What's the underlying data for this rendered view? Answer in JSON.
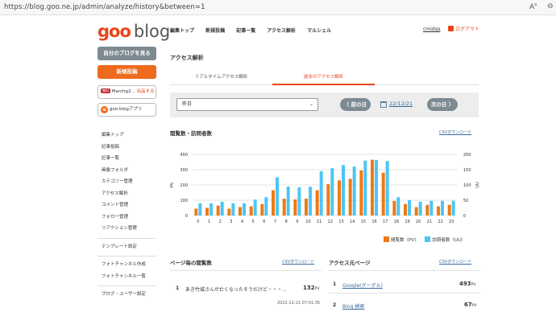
{
  "browser": {
    "url": "https://blog.goo.ne.jp/admin/analyze/history&between=1"
  },
  "header": {
    "logo_goo": "goo",
    "logo_blog": "blog",
    "nav": [
      "編集トップ",
      "新規投稿",
      "記事一覧",
      "アクセス解析",
      "マルシェル"
    ],
    "user": "cmidgs",
    "logout": "ログアウト"
  },
  "sidebar": {
    "my_blog": "自分のブログを見る",
    "new_post": "新規投稿",
    "marchg_badge": "無料",
    "marchg_name": "Marchg2...",
    "marchg_action": "出品する",
    "app_label": "goo blogアプリ",
    "links_group1": [
      "編集トップ",
      "記事投稿",
      "記事一覧",
      "画像フォルダ",
      "カテゴリー管理",
      "アクセス解析",
      "コメント管理",
      "フォロー管理",
      "リアクション管理"
    ],
    "links_group2": [
      "テンプレート設定"
    ],
    "links_group3": [
      "フォトチャンネル作成",
      "フォトチャンネル一覧"
    ],
    "links_group4": [
      "ブログ・ユーザー設定"
    ]
  },
  "main": {
    "title": "アクセス解析",
    "tabs": [
      "リアルタイムアクセス解析",
      "過去のアクセス解析"
    ],
    "period_select": "昨日",
    "prev_label": "〈 前の日",
    "date": "22/12/21",
    "next_label": "次の日 〉",
    "chart_heading": "閲覧数・訪問者数",
    "csv_label": "CSVダウンロード",
    "page_views_heading": "ページ毎の閲覧数",
    "referrers_heading": "アクセス元ページ",
    "page_views": [
      {
        "rank": "1",
        "title": "あき竹城さんが亡くなったそうだけど・・・...",
        "count": "132",
        "unit": "PV",
        "time": "2022-12-21 07:01:35"
      }
    ],
    "referrers": [
      {
        "rank": "1",
        "label": "Google(グーグル)",
        "count": "493",
        "unit": "PV"
      },
      {
        "rank": "2",
        "label": "Bing 検索",
        "count": "67",
        "unit": "PV"
      }
    ]
  },
  "colors": {
    "accent": "#e8451b",
    "pv_bar": "#ee7a14",
    "uu_bar": "#4cc6f4"
  },
  "chart_data": {
    "type": "bar",
    "categories": [
      "0",
      "1",
      "2",
      "3",
      "4",
      "5",
      "6",
      "7",
      "8",
      "9",
      "10",
      "11",
      "12",
      "13",
      "14",
      "15",
      "16",
      "17",
      "18",
      "19",
      "20",
      "21",
      "22",
      "23"
    ],
    "series": [
      {
        "name": "閲覧数（PV）",
        "axis": "left",
        "values": [
          45,
          50,
          65,
          45,
          55,
          60,
          75,
          165,
          110,
          105,
          110,
          165,
          205,
          230,
          240,
          295,
          365,
          280,
          95,
          75,
          55,
          70,
          60,
          70
        ]
      },
      {
        "name": "訪問者数（UU）",
        "axis": "right",
        "values": [
          40,
          40,
          45,
          40,
          40,
          52,
          60,
          125,
          95,
          92,
          94,
          145,
          155,
          165,
          160,
          180,
          182,
          178,
          60,
          50,
          45,
          48,
          48,
          48
        ]
      }
    ],
    "yleft": {
      "label": "PV",
      "ticks": [
        0,
        100,
        200,
        300,
        400
      ],
      "lim": [
        0,
        400
      ]
    },
    "yright": {
      "label": "UU",
      "ticks": [
        0,
        50,
        100,
        150,
        200
      ],
      "lim": [
        0,
        200
      ]
    },
    "grid": true,
    "legend_position": "bottom-right"
  }
}
